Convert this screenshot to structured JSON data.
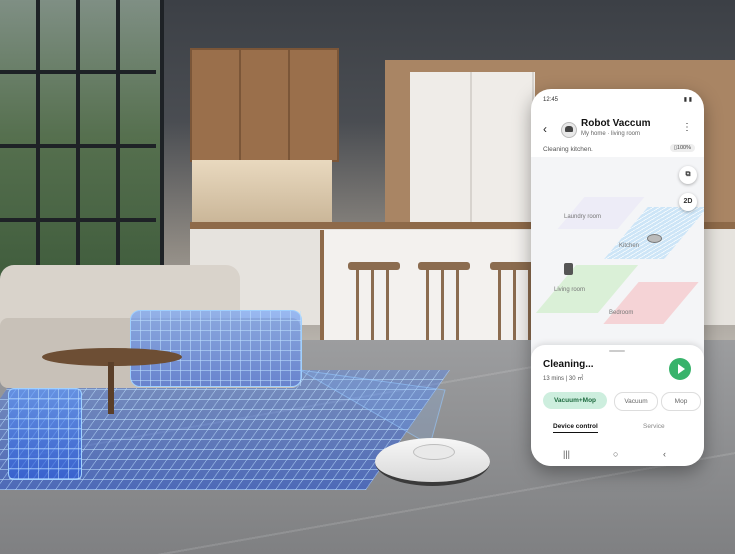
{
  "phone": {
    "status_time": "12:45",
    "status_icons": "▮ ▮",
    "app_title": "Robot Vaccum",
    "app_subtitle": "My home · living room",
    "status_message": "Cleaning kitchen.",
    "battery": "▯100%",
    "icons": {
      "back": "arrow-left-icon",
      "more": "more-vertical-icon",
      "layers": "layers-icon",
      "play": "play-icon"
    },
    "map": {
      "view_mode": "2D",
      "rooms": [
        {
          "name": "Laundry room"
        },
        {
          "name": "Kitchen"
        },
        {
          "name": "Living room"
        },
        {
          "name": "Bedroom"
        }
      ]
    },
    "sheet": {
      "title": "Cleaning...",
      "meta": "13 mins | 30 ㎡",
      "modes": [
        "Vacuum+Mop",
        "Vacuum",
        "Mop"
      ],
      "selected_mode": "Vacuum+Mop",
      "tabs": [
        "Device control",
        "Service"
      ],
      "active_tab": "Device control"
    },
    "navbar": {
      "recent": "|||",
      "home": "○",
      "back": "‹"
    },
    "accent": "#38b36b"
  }
}
